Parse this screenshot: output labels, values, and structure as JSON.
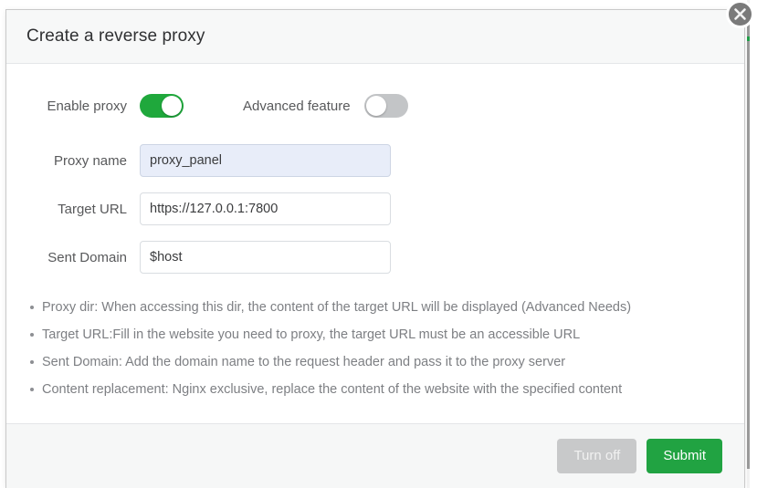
{
  "modal": {
    "title": "Create a reverse proxy",
    "close_icon": "close-icon",
    "toggles": {
      "enable_proxy": {
        "label": "Enable proxy",
        "state": "on",
        "on_color": "#1fa83c"
      },
      "advanced_feature": {
        "label": "Advanced feature",
        "state": "off",
        "off_color": "#c3c5c7"
      }
    },
    "fields": [
      {
        "label": "Proxy name",
        "value": "proxy_panel",
        "placeholder": "",
        "highlighted": true,
        "highlight_color": "#e8edf9"
      },
      {
        "label": "Target URL",
        "value": "https://127.0.0.1:7800",
        "placeholder": "",
        "highlighted": false
      },
      {
        "label": "Sent Domain",
        "value": "$host",
        "placeholder": "",
        "highlighted": false
      }
    ],
    "hints": [
      "Proxy dir: When accessing this dir, the content of the target URL will be displayed (Advanced Needs)",
      "Target URL:Fill in the website you need to proxy, the target URL must be an accessible URL",
      "Sent Domain: Add the domain name to the request header and pass it to the proxy server",
      "Content replacement: Nginx exclusive, replace the content of the website with the specified content"
    ],
    "footer": {
      "turn_off_label": "Turn off",
      "submit_label": "Submit",
      "submit_color": "#21a342",
      "turn_off_color": "#c8c9ca"
    }
  }
}
